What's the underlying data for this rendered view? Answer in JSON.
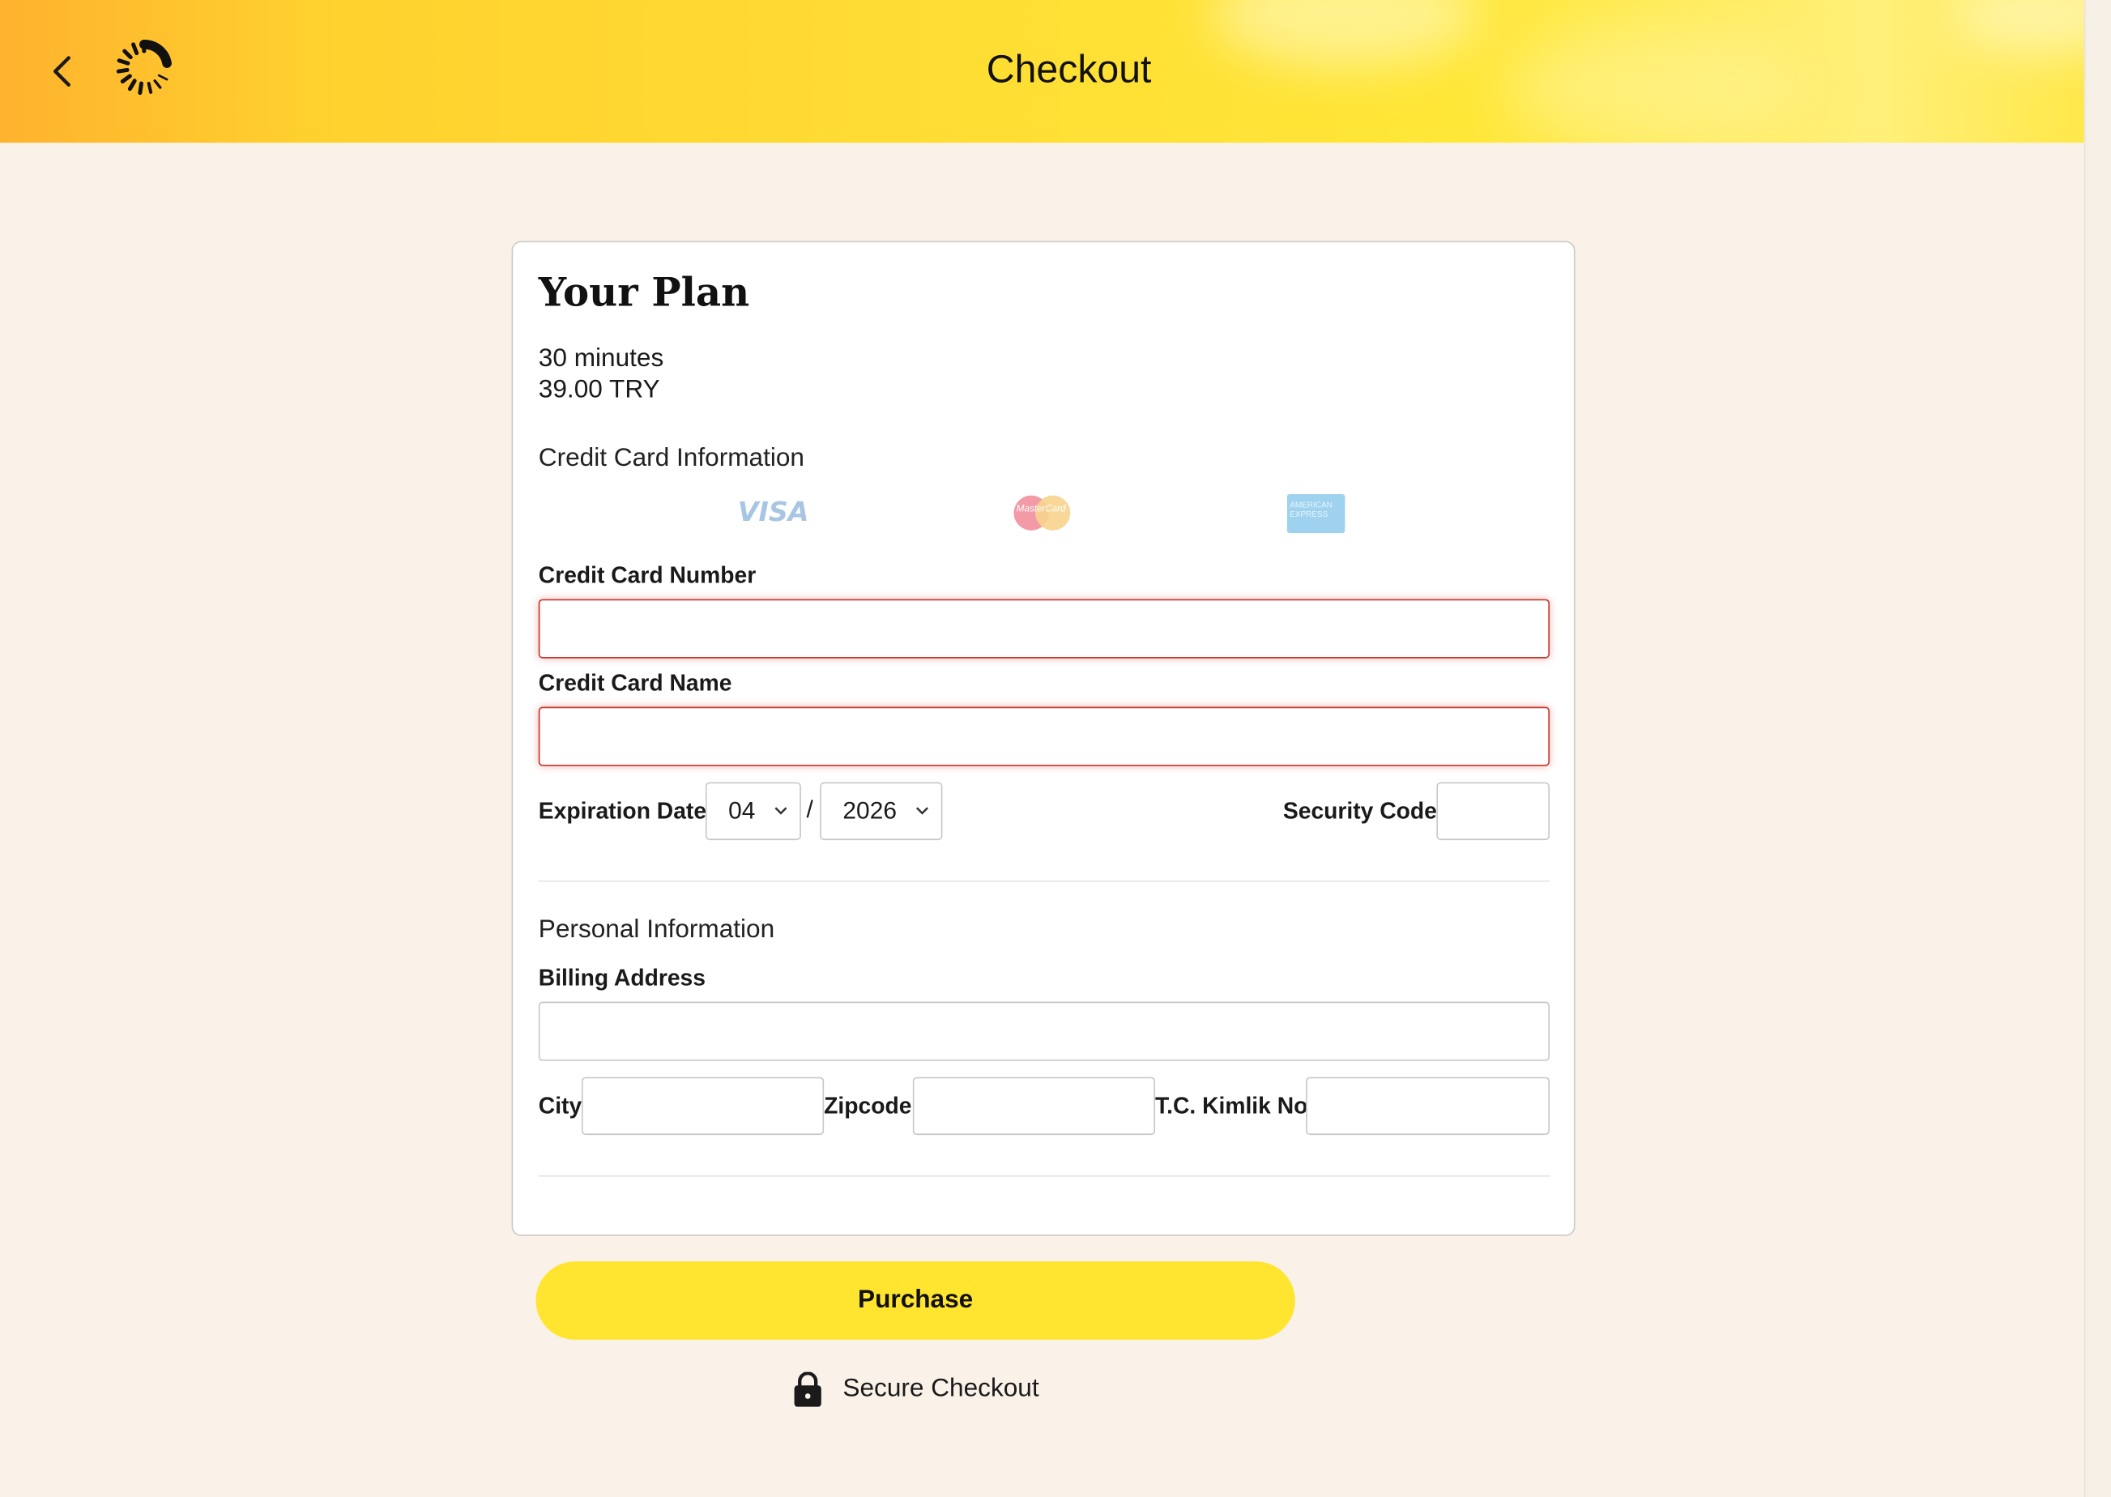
{
  "header": {
    "title": "Checkout",
    "back_icon": "chevron-left-icon",
    "logo_icon": "spinner-logo-icon"
  },
  "plan": {
    "title": "Your Plan",
    "duration": "30 minutes",
    "price": "39.00 TRY"
  },
  "credit_card": {
    "section_title": "Credit Card Information",
    "brands": [
      "VISA",
      "MasterCard",
      "AMERICAN EXPRESS"
    ],
    "number_label": "Credit Card Number",
    "number_value": "",
    "name_label": "Credit Card Name",
    "name_value": "",
    "expiration_label": "Expiration Date",
    "exp_month": "04",
    "exp_separator": "/",
    "exp_year": "2026",
    "security_label": "Security Code",
    "security_value": ""
  },
  "personal": {
    "section_title": "Personal Information",
    "billing_label": "Billing Address",
    "city_label": "City",
    "zip_label": "Zipcode",
    "tc_label": "T.C. Kimlik No"
  },
  "actions": {
    "purchase_label": "Purchase",
    "secure_label": "Secure Checkout"
  },
  "colors": {
    "accent": "#ffe52f",
    "error": "#c9362b",
    "background": "#faf2e9"
  }
}
